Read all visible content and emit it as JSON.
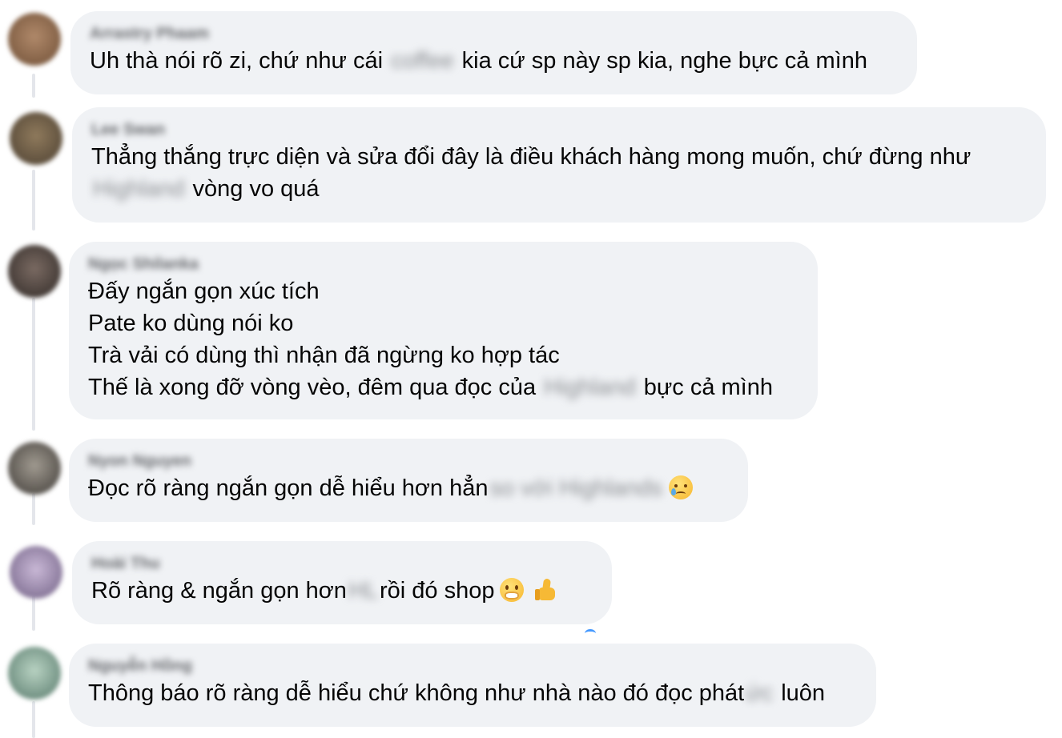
{
  "comments": [
    {
      "author": "Arrastry Phaam",
      "lines": [
        {
          "before": "Uh thà nói rõ zi, chứ như cái ",
          "blurred": "coffee",
          "after": " kia cứ sp này sp kia, nghe bực cả mình"
        }
      ]
    },
    {
      "author": "Lee Swan",
      "lines": [
        {
          "before": "Thẳng thắng trực diện và sửa đổi đây là điều khách hàng mong muốn, chứ đừng như",
          "blurred": "",
          "after": ""
        },
        {
          "before": "",
          "blurred": "Highland",
          "after": " vòng vo quá"
        }
      ]
    },
    {
      "author": "Ngọc Shilanka",
      "lines": [
        {
          "before": "Đấy ngắn gọn xúc tích",
          "blurred": "",
          "after": ""
        },
        {
          "before": "Pate ko dùng nói ko",
          "blurred": "",
          "after": ""
        },
        {
          "before": "Trà vải có dùng thì nhận đã ngừng ko hợp tác",
          "blurred": "",
          "after": ""
        },
        {
          "before": "Thế là xong đỡ vòng vèo, đêm qua đọc của ",
          "blurred": "Highland",
          "after": " bực cả mình"
        }
      ]
    },
    {
      "author": "Nyon Nguyen",
      "lines": [
        {
          "before": "Đọc rõ ràng ngắn gọn dễ hiểu hơn hẳn",
          "blurred": "so với Highlands",
          "after": ""
        }
      ],
      "emoji": "face-holding-back-tears-icon"
    },
    {
      "author": "Hoài Thu",
      "lines": [
        {
          "before": "Rõ ràng & ngắn gọn hơn",
          "blurred": "HL",
          "after": "rồi đó shop"
        }
      ],
      "emoji": "face-hand-over-mouth-icon",
      "emoji2": "thumbs-up-icon"
    },
    {
      "author": "Nguyễn Hồng",
      "lines": [
        {
          "before": "Thông báo rõ ràng dễ hiểu chứ không như nhà nào đó đọc phát",
          "blurred": "ức",
          "after": " luôn"
        }
      ]
    }
  ],
  "colors": {
    "bubble": "#f0f2f5",
    "text": "#050505",
    "name": "#65676b",
    "thread": "#e4e6eb"
  }
}
